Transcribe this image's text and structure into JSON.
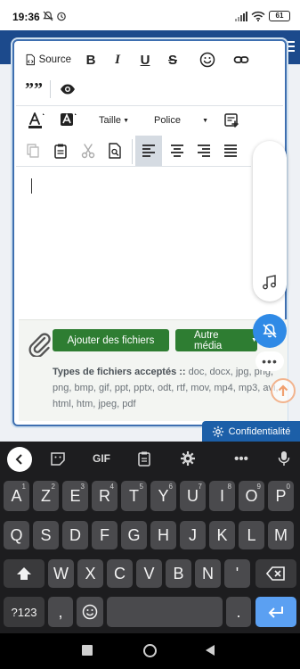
{
  "status": {
    "time": "19:36",
    "battery": "61"
  },
  "editor": {
    "source_label": "Source",
    "bold": "B",
    "italic": "I",
    "underline": "U",
    "strike": "S",
    "quote": "””",
    "size_label": "Taille",
    "font_label": "Police"
  },
  "files": {
    "add_button": "Ajouter des fichiers",
    "media_button": "Autre média",
    "accepted_label": "Types de fichiers acceptés ::",
    "accepted_types": "doc, docx, jpg, png, png, bmp, gif, ppt, pptx, odt, rtf, mov, mp4, mp3, avi, html, htm, jpeg, pdf"
  },
  "privacy": {
    "label": "Confidentialité"
  },
  "keyboard": {
    "toolbar": {
      "gif": "GIF"
    },
    "row1": [
      "A",
      "Z",
      "E",
      "R",
      "T",
      "Y",
      "U",
      "I",
      "O",
      "P"
    ],
    "row1_sup": [
      "1",
      "2",
      "3",
      "4",
      "5",
      "6",
      "7",
      "8",
      "9",
      "0"
    ],
    "row2": [
      "Q",
      "S",
      "D",
      "F",
      "G",
      "H",
      "J",
      "K",
      "L",
      "M"
    ],
    "row3": [
      "W",
      "X",
      "C",
      "V",
      "B",
      "N",
      "'"
    ],
    "bottom": {
      "symbols": "?123",
      "comma": ",",
      "period": "."
    }
  },
  "colors": {
    "accent": "#2f8ae6",
    "green": "#2e7d32",
    "header": "#1c4a8c"
  }
}
